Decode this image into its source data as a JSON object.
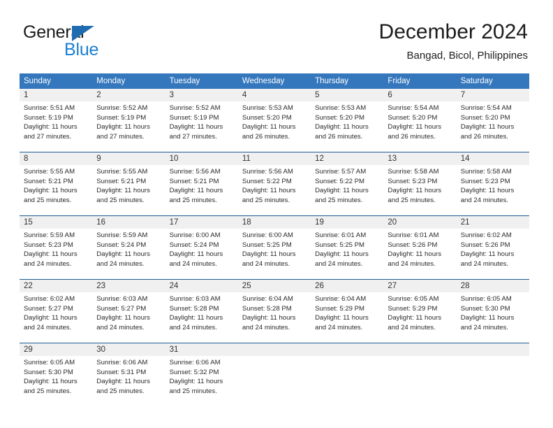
{
  "branding": {
    "name_part1": "General",
    "name_part2": "Blue",
    "accent_color": "#1a7fd4",
    "triangle_color": "#1f6bb0"
  },
  "header": {
    "title": "December 2024",
    "subtitle": "Bangad, Bicol, Philippines"
  },
  "calendar": {
    "header_color": "#3477bd",
    "weekday_headers": [
      "Sunday",
      "Monday",
      "Tuesday",
      "Wednesday",
      "Thursday",
      "Friday",
      "Saturday"
    ],
    "weeks": [
      [
        {
          "day": "1",
          "sunrise": "Sunrise: 5:51 AM",
          "sunset": "Sunset: 5:19 PM",
          "daylight_line1": "Daylight: 11 hours",
          "daylight_line2": "and 27 minutes."
        },
        {
          "day": "2",
          "sunrise": "Sunrise: 5:52 AM",
          "sunset": "Sunset: 5:19 PM",
          "daylight_line1": "Daylight: 11 hours",
          "daylight_line2": "and 27 minutes."
        },
        {
          "day": "3",
          "sunrise": "Sunrise: 5:52 AM",
          "sunset": "Sunset: 5:19 PM",
          "daylight_line1": "Daylight: 11 hours",
          "daylight_line2": "and 27 minutes."
        },
        {
          "day": "4",
          "sunrise": "Sunrise: 5:53 AM",
          "sunset": "Sunset: 5:20 PM",
          "daylight_line1": "Daylight: 11 hours",
          "daylight_line2": "and 26 minutes."
        },
        {
          "day": "5",
          "sunrise": "Sunrise: 5:53 AM",
          "sunset": "Sunset: 5:20 PM",
          "daylight_line1": "Daylight: 11 hours",
          "daylight_line2": "and 26 minutes."
        },
        {
          "day": "6",
          "sunrise": "Sunrise: 5:54 AM",
          "sunset": "Sunset: 5:20 PM",
          "daylight_line1": "Daylight: 11 hours",
          "daylight_line2": "and 26 minutes."
        },
        {
          "day": "7",
          "sunrise": "Sunrise: 5:54 AM",
          "sunset": "Sunset: 5:20 PM",
          "daylight_line1": "Daylight: 11 hours",
          "daylight_line2": "and 26 minutes."
        }
      ],
      [
        {
          "day": "8",
          "sunrise": "Sunrise: 5:55 AM",
          "sunset": "Sunset: 5:21 PM",
          "daylight_line1": "Daylight: 11 hours",
          "daylight_line2": "and 25 minutes."
        },
        {
          "day": "9",
          "sunrise": "Sunrise: 5:55 AM",
          "sunset": "Sunset: 5:21 PM",
          "daylight_line1": "Daylight: 11 hours",
          "daylight_line2": "and 25 minutes."
        },
        {
          "day": "10",
          "sunrise": "Sunrise: 5:56 AM",
          "sunset": "Sunset: 5:21 PM",
          "daylight_line1": "Daylight: 11 hours",
          "daylight_line2": "and 25 minutes."
        },
        {
          "day": "11",
          "sunrise": "Sunrise: 5:56 AM",
          "sunset": "Sunset: 5:22 PM",
          "daylight_line1": "Daylight: 11 hours",
          "daylight_line2": "and 25 minutes."
        },
        {
          "day": "12",
          "sunrise": "Sunrise: 5:57 AM",
          "sunset": "Sunset: 5:22 PM",
          "daylight_line1": "Daylight: 11 hours",
          "daylight_line2": "and 25 minutes."
        },
        {
          "day": "13",
          "sunrise": "Sunrise: 5:58 AM",
          "sunset": "Sunset: 5:23 PM",
          "daylight_line1": "Daylight: 11 hours",
          "daylight_line2": "and 25 minutes."
        },
        {
          "day": "14",
          "sunrise": "Sunrise: 5:58 AM",
          "sunset": "Sunset: 5:23 PM",
          "daylight_line1": "Daylight: 11 hours",
          "daylight_line2": "and 24 minutes."
        }
      ],
      [
        {
          "day": "15",
          "sunrise": "Sunrise: 5:59 AM",
          "sunset": "Sunset: 5:23 PM",
          "daylight_line1": "Daylight: 11 hours",
          "daylight_line2": "and 24 minutes."
        },
        {
          "day": "16",
          "sunrise": "Sunrise: 5:59 AM",
          "sunset": "Sunset: 5:24 PM",
          "daylight_line1": "Daylight: 11 hours",
          "daylight_line2": "and 24 minutes."
        },
        {
          "day": "17",
          "sunrise": "Sunrise: 6:00 AM",
          "sunset": "Sunset: 5:24 PM",
          "daylight_line1": "Daylight: 11 hours",
          "daylight_line2": "and 24 minutes."
        },
        {
          "day": "18",
          "sunrise": "Sunrise: 6:00 AM",
          "sunset": "Sunset: 5:25 PM",
          "daylight_line1": "Daylight: 11 hours",
          "daylight_line2": "and 24 minutes."
        },
        {
          "day": "19",
          "sunrise": "Sunrise: 6:01 AM",
          "sunset": "Sunset: 5:25 PM",
          "daylight_line1": "Daylight: 11 hours",
          "daylight_line2": "and 24 minutes."
        },
        {
          "day": "20",
          "sunrise": "Sunrise: 6:01 AM",
          "sunset": "Sunset: 5:26 PM",
          "daylight_line1": "Daylight: 11 hours",
          "daylight_line2": "and 24 minutes."
        },
        {
          "day": "21",
          "sunrise": "Sunrise: 6:02 AM",
          "sunset": "Sunset: 5:26 PM",
          "daylight_line1": "Daylight: 11 hours",
          "daylight_line2": "and 24 minutes."
        }
      ],
      [
        {
          "day": "22",
          "sunrise": "Sunrise: 6:02 AM",
          "sunset": "Sunset: 5:27 PM",
          "daylight_line1": "Daylight: 11 hours",
          "daylight_line2": "and 24 minutes."
        },
        {
          "day": "23",
          "sunrise": "Sunrise: 6:03 AM",
          "sunset": "Sunset: 5:27 PM",
          "daylight_line1": "Daylight: 11 hours",
          "daylight_line2": "and 24 minutes."
        },
        {
          "day": "24",
          "sunrise": "Sunrise: 6:03 AM",
          "sunset": "Sunset: 5:28 PM",
          "daylight_line1": "Daylight: 11 hours",
          "daylight_line2": "and 24 minutes."
        },
        {
          "day": "25",
          "sunrise": "Sunrise: 6:04 AM",
          "sunset": "Sunset: 5:28 PM",
          "daylight_line1": "Daylight: 11 hours",
          "daylight_line2": "and 24 minutes."
        },
        {
          "day": "26",
          "sunrise": "Sunrise: 6:04 AM",
          "sunset": "Sunset: 5:29 PM",
          "daylight_line1": "Daylight: 11 hours",
          "daylight_line2": "and 24 minutes."
        },
        {
          "day": "27",
          "sunrise": "Sunrise: 6:05 AM",
          "sunset": "Sunset: 5:29 PM",
          "daylight_line1": "Daylight: 11 hours",
          "daylight_line2": "and 24 minutes."
        },
        {
          "day": "28",
          "sunrise": "Sunrise: 6:05 AM",
          "sunset": "Sunset: 5:30 PM",
          "daylight_line1": "Daylight: 11 hours",
          "daylight_line2": "and 24 minutes."
        }
      ],
      [
        {
          "day": "29",
          "sunrise": "Sunrise: 6:05 AM",
          "sunset": "Sunset: 5:30 PM",
          "daylight_line1": "Daylight: 11 hours",
          "daylight_line2": "and 25 minutes."
        },
        {
          "day": "30",
          "sunrise": "Sunrise: 6:06 AM",
          "sunset": "Sunset: 5:31 PM",
          "daylight_line1": "Daylight: 11 hours",
          "daylight_line2": "and 25 minutes."
        },
        {
          "day": "31",
          "sunrise": "Sunrise: 6:06 AM",
          "sunset": "Sunset: 5:32 PM",
          "daylight_line1": "Daylight: 11 hours",
          "daylight_line2": "and 25 minutes."
        },
        {
          "day": "",
          "sunrise": "",
          "sunset": "",
          "daylight_line1": "",
          "daylight_line2": ""
        },
        {
          "day": "",
          "sunrise": "",
          "sunset": "",
          "daylight_line1": "",
          "daylight_line2": ""
        },
        {
          "day": "",
          "sunrise": "",
          "sunset": "",
          "daylight_line1": "",
          "daylight_line2": ""
        },
        {
          "day": "",
          "sunrise": "",
          "sunset": "",
          "daylight_line1": "",
          "daylight_line2": ""
        }
      ]
    ]
  }
}
